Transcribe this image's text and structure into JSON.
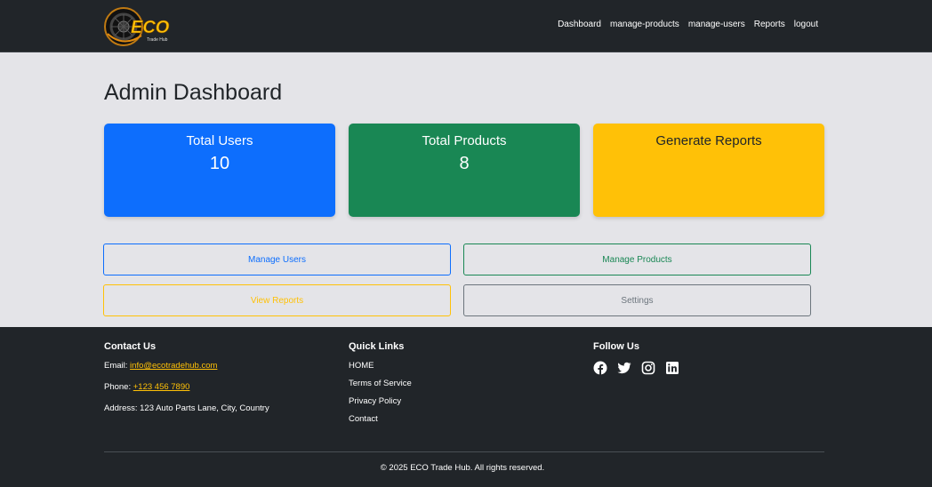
{
  "brand": {
    "logo_text": "ECO",
    "logo_subtext": "Trade Hub"
  },
  "nav": {
    "items": [
      {
        "label": "Dashboard"
      },
      {
        "label": "manage-products"
      },
      {
        "label": "manage-users"
      },
      {
        "label": "Reports"
      },
      {
        "label": "logout"
      }
    ]
  },
  "main": {
    "title": "Admin Dashboard",
    "cards": {
      "users": {
        "title": "Total Users",
        "value": "10"
      },
      "products": {
        "title": "Total Products",
        "value": "8"
      },
      "reports": {
        "title": "Generate Reports"
      }
    },
    "buttons": {
      "manage_users": "Manage Users",
      "manage_products": "Manage Products",
      "view_reports": "View Reports",
      "settings": "Settings"
    }
  },
  "footer": {
    "contact": {
      "heading": "Contact Us",
      "email_label": "Email: ",
      "email": "info@ecotradehub.com",
      "phone_label": "Phone: ",
      "phone": "+123 456 7890",
      "address": "Address: 123 Auto Parts Lane, City, Country"
    },
    "quick_links": {
      "heading": "Quick Links",
      "items": [
        {
          "label": "HOME"
        },
        {
          "label": "Terms of Service"
        },
        {
          "label": "Privacy Policy"
        },
        {
          "label": "Contact"
        }
      ]
    },
    "follow": {
      "heading": "Follow Us",
      "icons": [
        "facebook-icon",
        "twitter-icon",
        "instagram-icon",
        "linkedin-icon"
      ]
    },
    "copyright": "© 2025 ECO Trade Hub. All rights reserved."
  },
  "colors": {
    "navbar_bg": "#212529",
    "primary": "#0d6efd",
    "success": "#198754",
    "warning": "#ffc107",
    "secondary": "#6c757d",
    "page_bg": "#e4e4e8"
  }
}
